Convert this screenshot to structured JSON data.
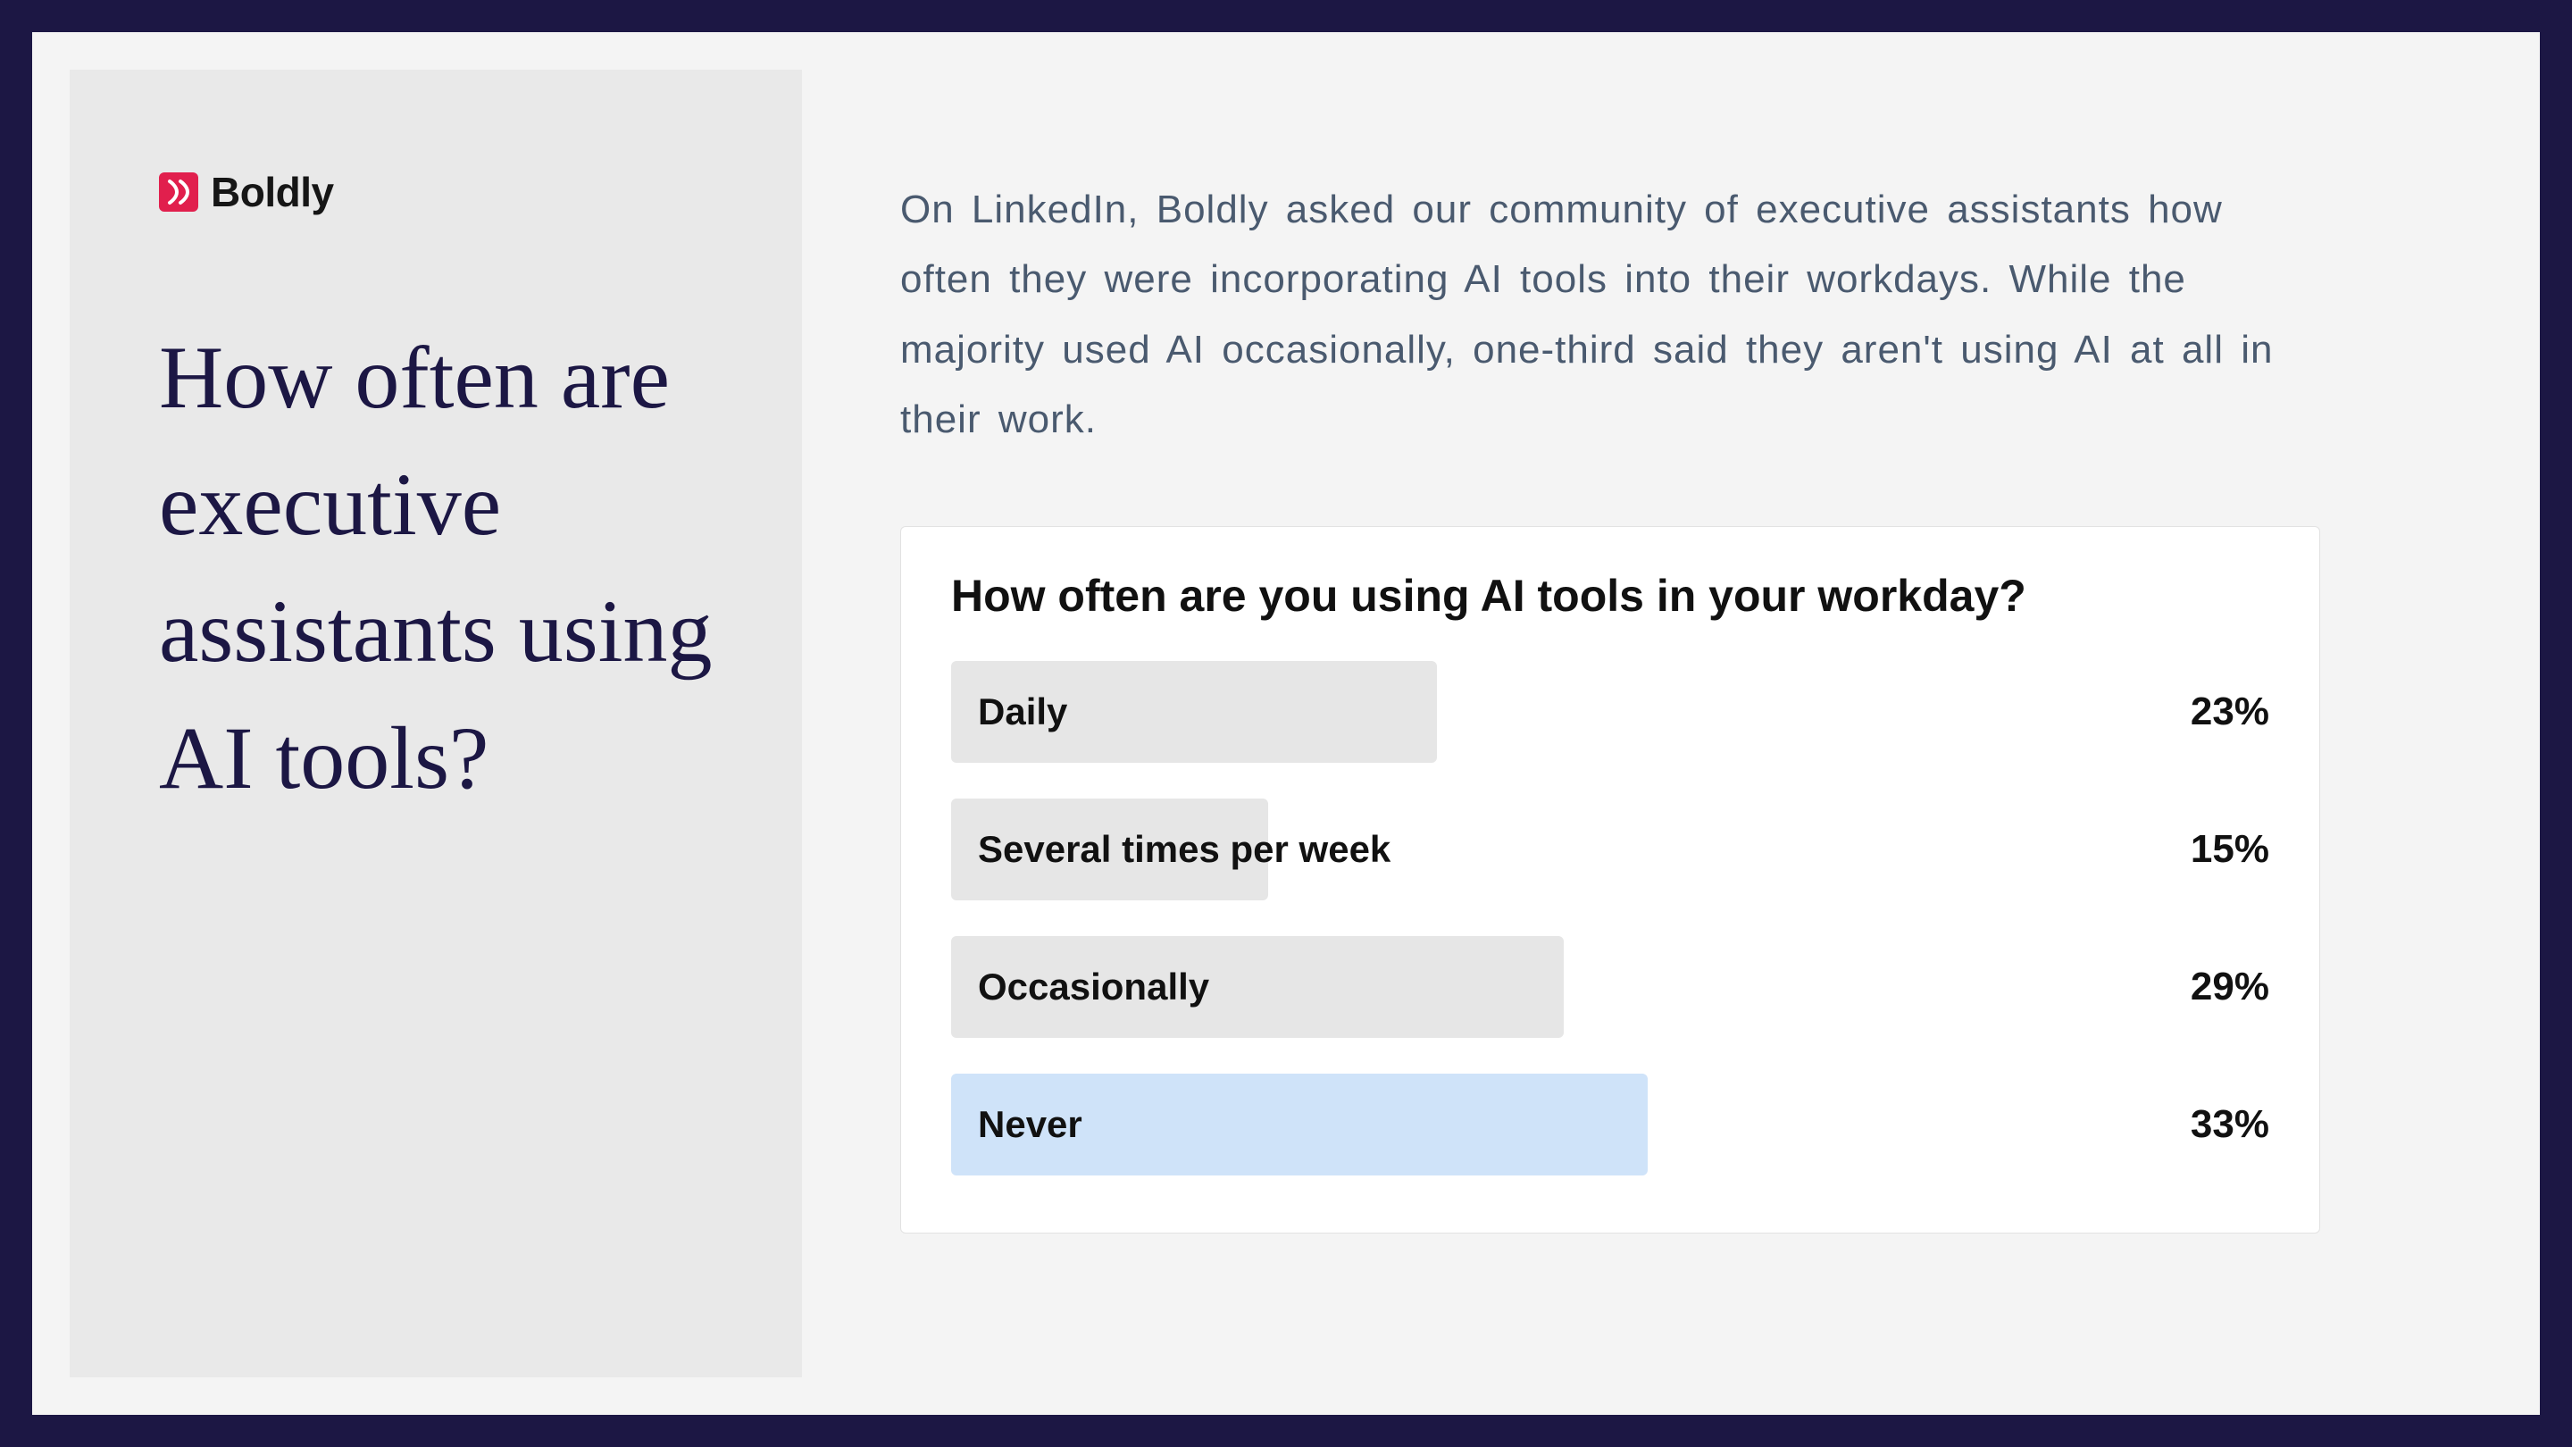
{
  "brand": {
    "name": "Boldly",
    "accent_color": "#e11f4d"
  },
  "headline": "How often are executive assistants using AI tools?",
  "intro_paragraph": "On LinkedIn, Boldly asked our community of executive assistants how often they were incorporating AI tools into their workdays. While the majority used AI occasionally, one-third said they aren't using AI at all in their work.",
  "poll": {
    "question": "How often are you using AI tools in your workday?",
    "rows": [
      {
        "label": "Daily",
        "pct_text": "23%",
        "highlight": false
      },
      {
        "label": "Several times per week",
        "pct_text": "15%",
        "highlight": false
      },
      {
        "label": "Occasionally",
        "pct_text": "29%",
        "highlight": false
      },
      {
        "label": "Never",
        "pct_text": "33%",
        "highlight": true
      }
    ]
  },
  "colors": {
    "frame_border": "#1c1744",
    "canvas_bg": "#f4f4f4",
    "side_panel_bg": "#e9e9e9",
    "headline_color": "#1c1744",
    "intro_color": "#4a5a6f",
    "bar_grey": "#e6e6e6",
    "bar_blue": "#cfe3f9"
  },
  "chart_data": {
    "type": "bar",
    "title": "How often are you using AI tools in your workday?",
    "xlabel": "",
    "ylabel": "",
    "categories": [
      "Daily",
      "Several times per week",
      "Occasionally",
      "Never"
    ],
    "values": [
      23,
      15,
      29,
      33
    ],
    "ylim": [
      0,
      100
    ],
    "highlight_index": 3
  }
}
